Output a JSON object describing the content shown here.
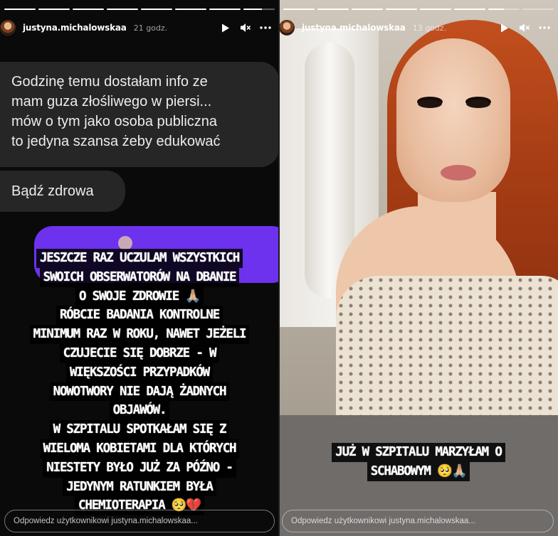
{
  "left_story": {
    "progress": [
      1,
      1,
      1,
      1,
      1,
      1,
      1,
      0.6
    ],
    "username": "justyna.michalowskaa",
    "time": "21 godz.",
    "dm_message_1": [
      "Godzinę temu dostałam info ze",
      "mam guza złośliwego w piersi...",
      "mów o tym jako osoba publiczna",
      "to jedyna szansa żeby edukować"
    ],
    "dm_message_2": "Bądź zdrowa",
    "caption": [
      "JESZCZE RAZ UCZULAM WSZYSTKICH",
      "SWOICH OBSERWATORÓW NA DBANIE",
      "O SWOJE ZDROWIE 🙏🏼",
      "RÓBCIE BADANIA KONTROLNE",
      "MINIMUM RAZ W ROKU, NAWET JEŻELI",
      "CZUJECIE SIĘ DOBRZE - W",
      "WIĘKSZOŚCI PRZYPADKÓW",
      "NOWOTWORY NIE DAJĄ ŻADNYCH",
      "OBJAWÓW.",
      "W SZPITALU SPOTKAŁAM SIĘ Z",
      "WIELOMA KOBIETAMI DLA KTÓRYCH",
      "NIESTETY BYŁO JUŻ ZA PÓŹNO -",
      "JEDYNYM RATUNKIEM BYŁA",
      "CHEMIOTERAPIA 🥺💔"
    ],
    "reply_placeholder": "Odpowiedz użytkownikowi justyna.michalowskaa..."
  },
  "right_story": {
    "progress": [
      1,
      1,
      1,
      1,
      1,
      1,
      0.5,
      0
    ],
    "username": "justyna.michalowskaa",
    "time": "13 godz.",
    "caption": [
      "JUŻ W SZPITALU MARZYŁAM O",
      "SCHABOWYM 🥺🙏🏼"
    ],
    "reply_placeholder": "Odpowiedz użytkownikowi justyna.michalowskaa..."
  },
  "icons": {
    "play": "play-icon",
    "mute": "speaker-muted-icon",
    "more": "more-options-icon"
  },
  "colors": {
    "dm_bubble": "#262626",
    "sent_bubble": "#6d32ee",
    "caption_bg": "#000000",
    "caption_text": "#ffffff"
  }
}
